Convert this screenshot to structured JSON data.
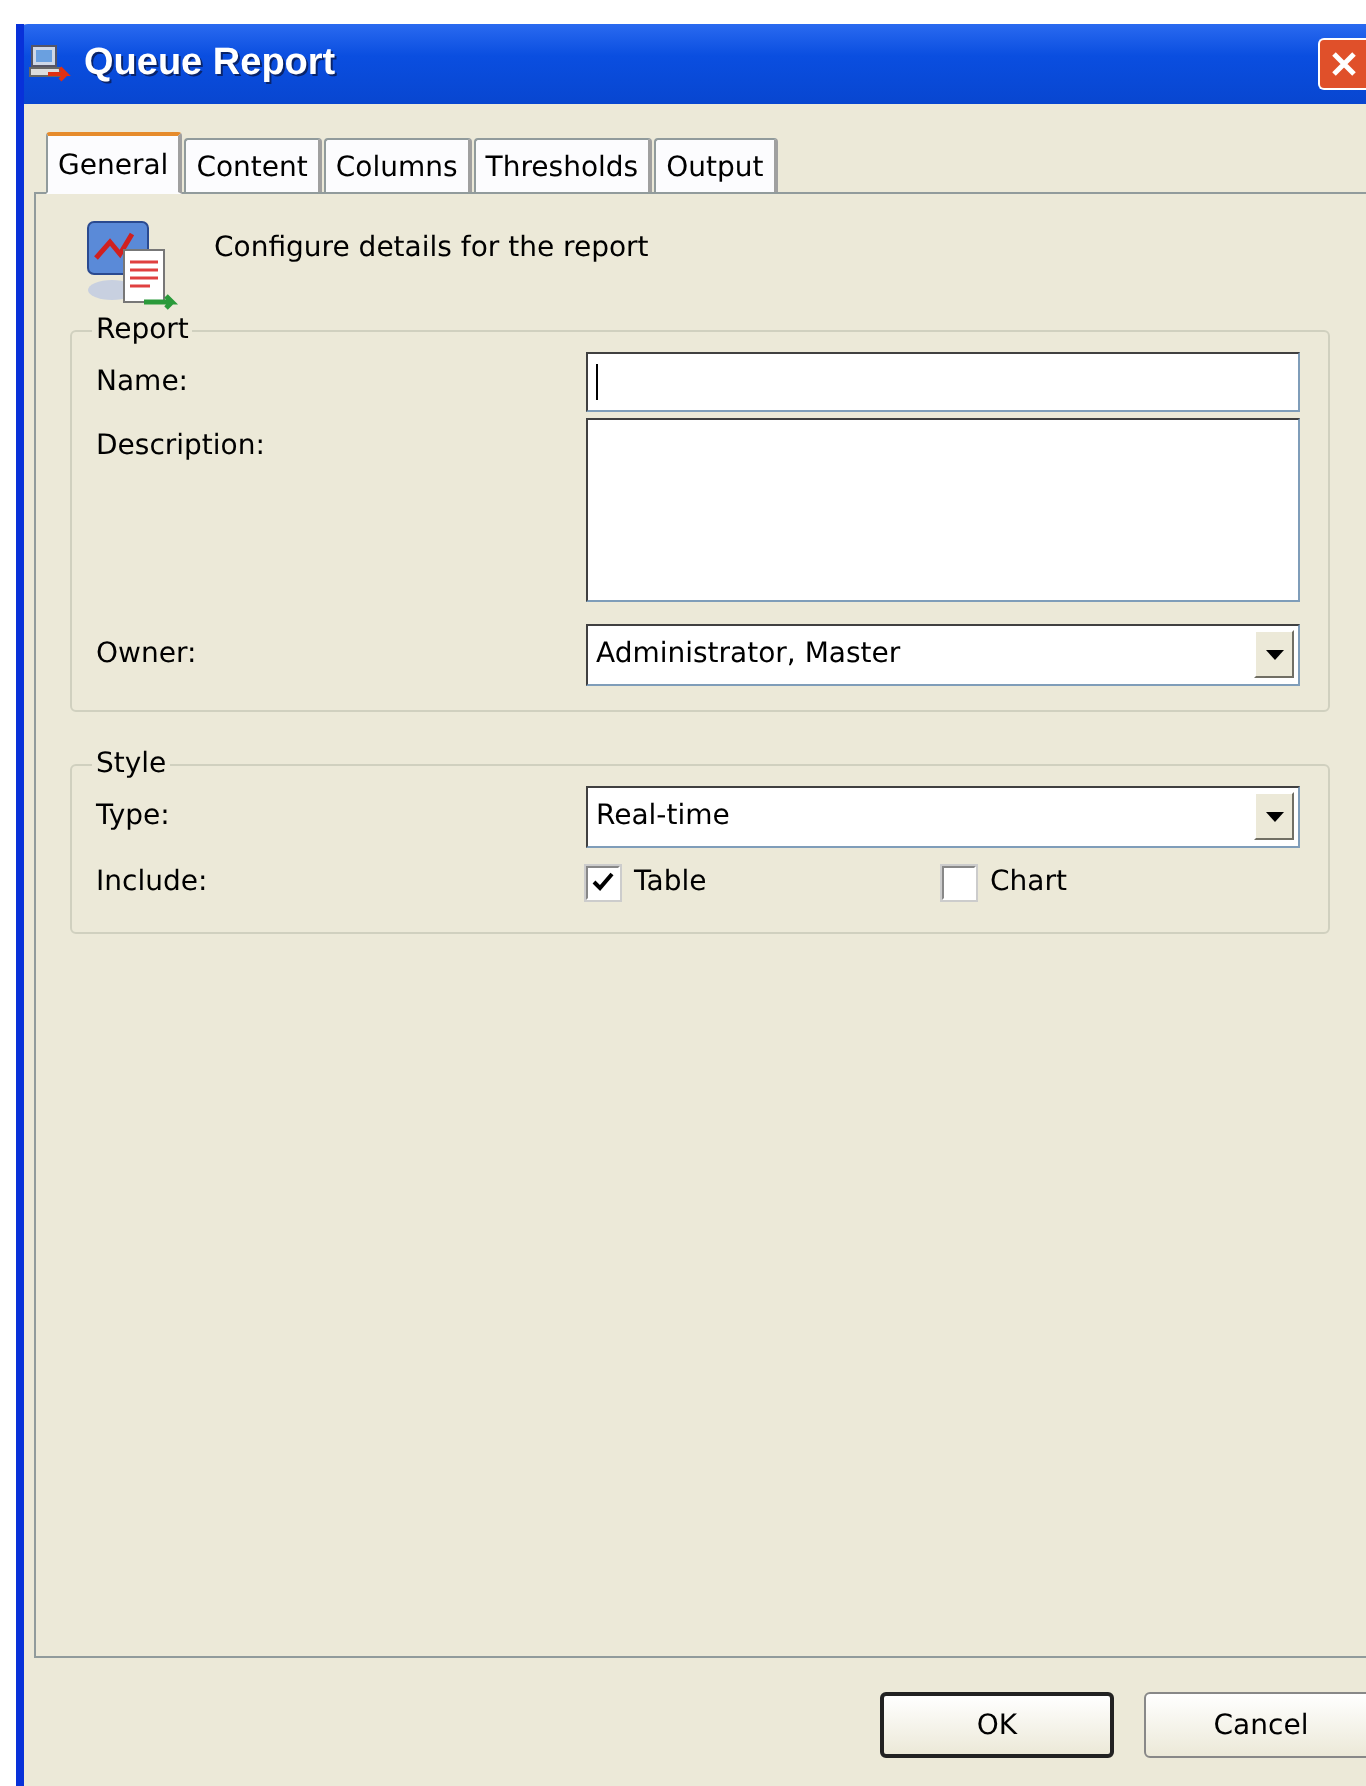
{
  "window": {
    "title": "Queue Report"
  },
  "tabs": [
    {
      "label": "General",
      "selected": true
    },
    {
      "label": "Content",
      "selected": false
    },
    {
      "label": "Columns",
      "selected": false
    },
    {
      "label": "Thresholds",
      "selected": false
    },
    {
      "label": "Output",
      "selected": false
    }
  ],
  "header": {
    "text": "Configure details for the report"
  },
  "groups": [
    {
      "title": "Report",
      "rows": [
        {
          "kind": "text",
          "label": "Name:",
          "value": ""
        },
        {
          "kind": "textarea",
          "label": "Description:",
          "value": ""
        },
        {
          "kind": "dropdown",
          "label": "Owner:",
          "value": "Administrator, Master"
        }
      ]
    },
    {
      "title": "Style",
      "rows": [
        {
          "kind": "dropdown",
          "label": "Type:",
          "value": "Real-time"
        },
        {
          "kind": "checks",
          "label": "Include:",
          "options": [
            {
              "label": "Table",
              "checked": true
            },
            {
              "label": "Chart",
              "checked": false
            }
          ]
        }
      ]
    }
  ],
  "buttons": [
    {
      "label": "OK",
      "default": true
    },
    {
      "label": "Cancel",
      "default": false
    }
  ]
}
